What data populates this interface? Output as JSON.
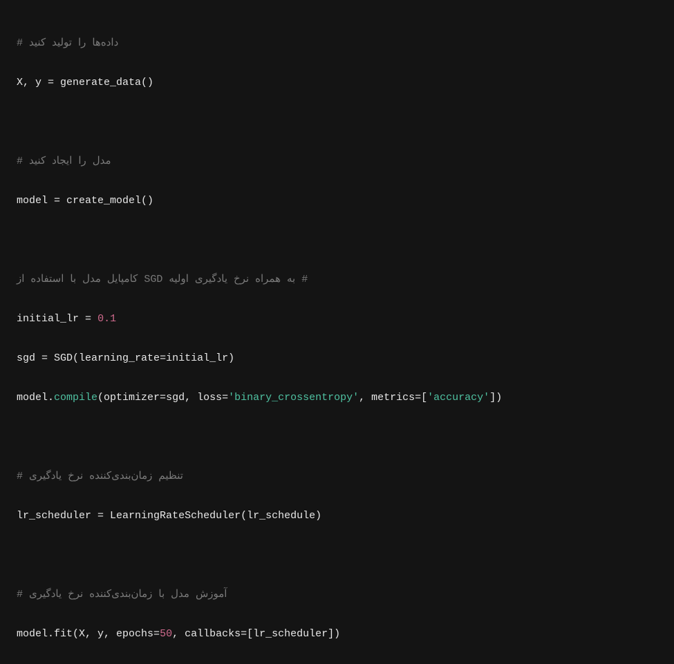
{
  "code": {
    "comment1_text": "داده‌ها را تولید کنید",
    "comment1_hash": "# ",
    "line2_a": "X, y ",
    "line2_b": "=",
    "line2_c": " generate_data()",
    "comment2_text": "مدل را ایجاد کنید",
    "comment2_hash": "# ",
    "line5_a": "model ",
    "line5_b": "=",
    "line5_c": " create_model()",
    "comment3_text": "به همراه نرخ یادگیری اولیه SGD کامپایل مدل با استفاده از",
    "comment3_hash": " #",
    "line8_a": "initial_lr ",
    "line8_b": "=",
    "line8_c": " ",
    "line8_num": "0.1",
    "line9_a": "sgd ",
    "line9_b": "=",
    "line9_c": " SGD(learning_rate",
    "line9_d": "=",
    "line9_e": "initial_lr)",
    "line10_a": "model.",
    "line10_method": "compile",
    "line10_b": "(optimizer",
    "line10_c": "=",
    "line10_d": "sgd, loss",
    "line10_e": "=",
    "line10_str1": "'binary_crossentropy'",
    "line10_f": ", metrics",
    "line10_g": "=",
    "line10_h": "[",
    "line10_str2": "'accuracy'",
    "line10_i": "])",
    "comment4_text": "تنظیم زمان‌بندی‌کننده نرخ یادگیری",
    "comment4_hash": "# ",
    "line13_a": "lr_scheduler ",
    "line13_b": "=",
    "line13_c": " LearningRateScheduler(lr_schedule)",
    "comment5_text": "آموزش مدل با زمان‌بندی‌کننده نرخ یادگیری",
    "comment5_hash": "# ",
    "line16_a": "model.fit(X, y, epochs",
    "line16_b": "=",
    "line16_num": "50",
    "line16_c": ", callbacks",
    "line16_d": "=",
    "line16_e": "[lr_scheduler])"
  }
}
